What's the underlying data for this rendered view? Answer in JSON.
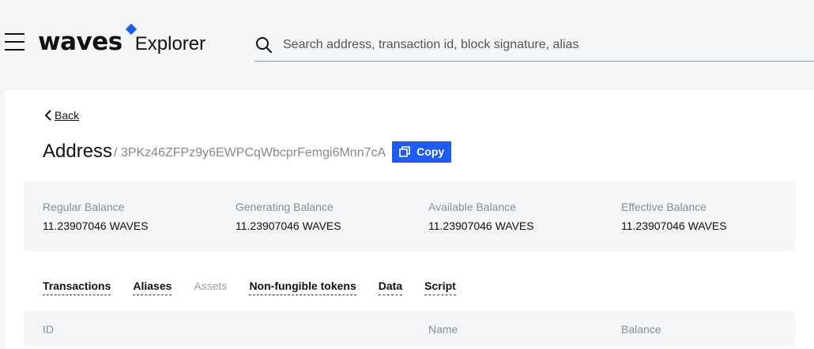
{
  "header": {
    "logo_text": "waves",
    "app_name": "Explorer",
    "search_placeholder": "Search address, transaction id, block signature, alias"
  },
  "page": {
    "back_label": "Back",
    "title": "Address",
    "address": "/ 3PKz46ZFPz9y6EWPCqWbcprFemgi6Mnn7cA",
    "copy_label": "Copy"
  },
  "balances": [
    {
      "label": "Regular Balance",
      "value": "11.23907046 WAVES"
    },
    {
      "label": "Generating Balance",
      "value": "11.23907046 WAVES"
    },
    {
      "label": "Available Balance",
      "value": "11.23907046 WAVES"
    },
    {
      "label": "Effective Balance",
      "value": "11.23907046 WAVES"
    }
  ],
  "tabs": [
    {
      "label": "Transactions",
      "active": false
    },
    {
      "label": "Aliases",
      "active": false
    },
    {
      "label": "Assets",
      "active": true
    },
    {
      "label": "Non-fungible tokens",
      "active": false
    },
    {
      "label": "Data",
      "active": false
    },
    {
      "label": "Script",
      "active": false
    }
  ],
  "table": {
    "columns": [
      "ID",
      "Name",
      "Balance"
    ]
  },
  "colors": {
    "accent": "#1f5af6",
    "background": "#f4f5f7"
  }
}
